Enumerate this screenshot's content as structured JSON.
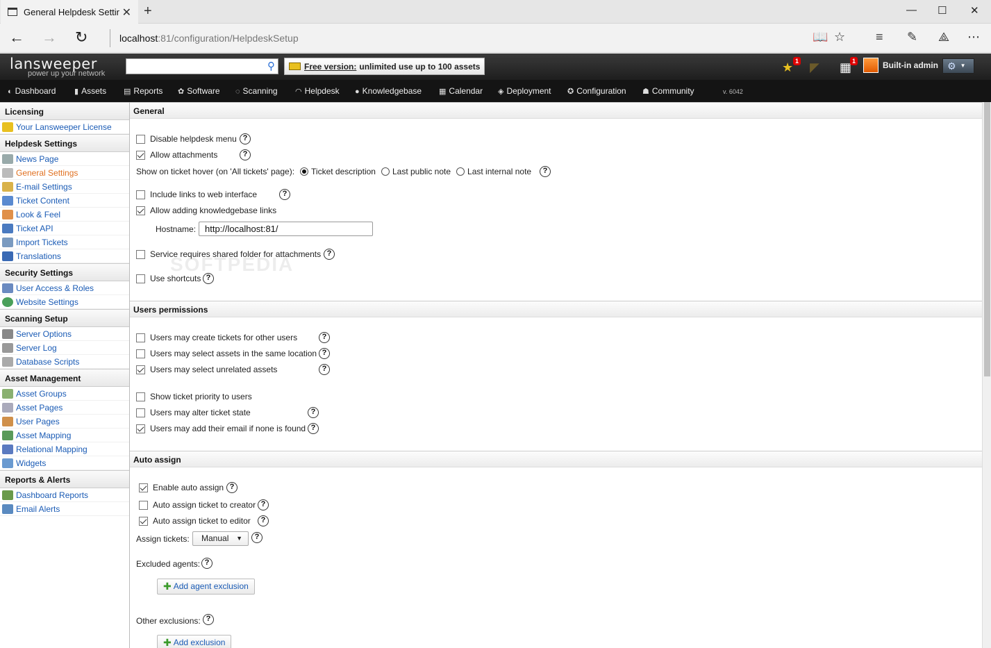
{
  "browser": {
    "tab_title": "General Helpdesk Settir",
    "tab_close": "✕",
    "new_tab": "+",
    "url_host": "localhost",
    "url_rest": ":81/configuration/HelpdeskSetup",
    "minimize": "—",
    "maximize": "☐",
    "close": "✕"
  },
  "header": {
    "logo_main": "lansweeper",
    "logo_tagline": "power up your network",
    "search_placeholder": "",
    "free_label": "Free version:",
    "free_text": "unlimited use up to 100 assets",
    "star_badge": "1",
    "calendar_badge": "1",
    "user": "Built-in admin",
    "version": "v. 6042"
  },
  "menu": [
    {
      "label": "Dashboard",
      "icon": "dashboard-icon"
    },
    {
      "label": "Assets",
      "icon": "assets-icon"
    },
    {
      "label": "Reports",
      "icon": "reports-icon"
    },
    {
      "label": "Software",
      "icon": "software-icon"
    },
    {
      "label": "Scanning",
      "icon": "scanning-icon"
    },
    {
      "label": "Helpdesk",
      "icon": "helpdesk-icon"
    },
    {
      "label": "Knowledgebase",
      "icon": "knowledgebase-icon"
    },
    {
      "label": "Calendar",
      "icon": "calendar-icon"
    },
    {
      "label": "Deployment",
      "icon": "deployment-icon"
    },
    {
      "label": "Configuration",
      "icon": "configuration-icon"
    },
    {
      "label": "Community",
      "icon": "community-icon"
    }
  ],
  "sidebar": {
    "licensing": {
      "title": "Licensing",
      "items": [
        "Your Lansweeper License"
      ]
    },
    "helpdesk": {
      "title": "Helpdesk Settings",
      "items": [
        "News Page",
        "General Settings",
        "E-mail Settings",
        "Ticket Content",
        "Look & Feel",
        "Ticket API",
        "Import Tickets",
        "Translations"
      ]
    },
    "security": {
      "title": "Security Settings",
      "items": [
        "User Access & Roles",
        "Website Settings"
      ]
    },
    "scanning": {
      "title": "Scanning Setup",
      "items": [
        "Server Options",
        "Server Log",
        "Database Scripts"
      ]
    },
    "asset": {
      "title": "Asset Management",
      "items": [
        "Asset Groups",
        "Asset Pages",
        "User Pages",
        "Asset Mapping",
        "Relational Mapping",
        "Widgets"
      ]
    },
    "reports": {
      "title": "Reports & Alerts",
      "items": [
        "Dashboard Reports",
        "Email Alerts"
      ]
    }
  },
  "general": {
    "title": "General",
    "disable_menu": "Disable helpdesk menu",
    "allow_attachments": "Allow attachments",
    "hover_label": "Show on ticket hover (on 'All tickets' page):",
    "hover_opt1": "Ticket description",
    "hover_opt2": "Last public note",
    "hover_opt3": "Last internal note",
    "include_links": "Include links to web interface",
    "allow_kb_links": "Allow adding knowledgebase links",
    "hostname_label": "Hostname:",
    "hostname_value": "http://localhost:81/",
    "shared_folder": "Service requires shared folder for attachments",
    "use_shortcuts": "Use shortcuts",
    "help": "?"
  },
  "permissions": {
    "title": "Users permissions",
    "create_for_others": "Users may create tickets for other users",
    "same_location": "Users may select assets in the same location",
    "unrelated": "Users may select unrelated assets",
    "show_priority": "Show ticket priority to users",
    "alter_state": "Users may alter ticket state",
    "add_email": "Users may add their email if none is found"
  },
  "autoassign": {
    "title": "Auto assign",
    "enable": "Enable auto assign",
    "to_creator": "Auto assign ticket to creator",
    "to_editor": "Auto assign ticket to editor",
    "assign_label": "Assign tickets:",
    "assign_value": "Manual",
    "excluded_label": "Excluded agents:",
    "add_agent_exclusion": "Add agent exclusion",
    "other_label": "Other exclusions:",
    "add_exclusion": "Add exclusion"
  },
  "watermark": "SOFTPEDIA",
  "colors": {
    "link": "#1a5bb5",
    "active": "#e07020",
    "header_bg": "#1e1e1e"
  }
}
